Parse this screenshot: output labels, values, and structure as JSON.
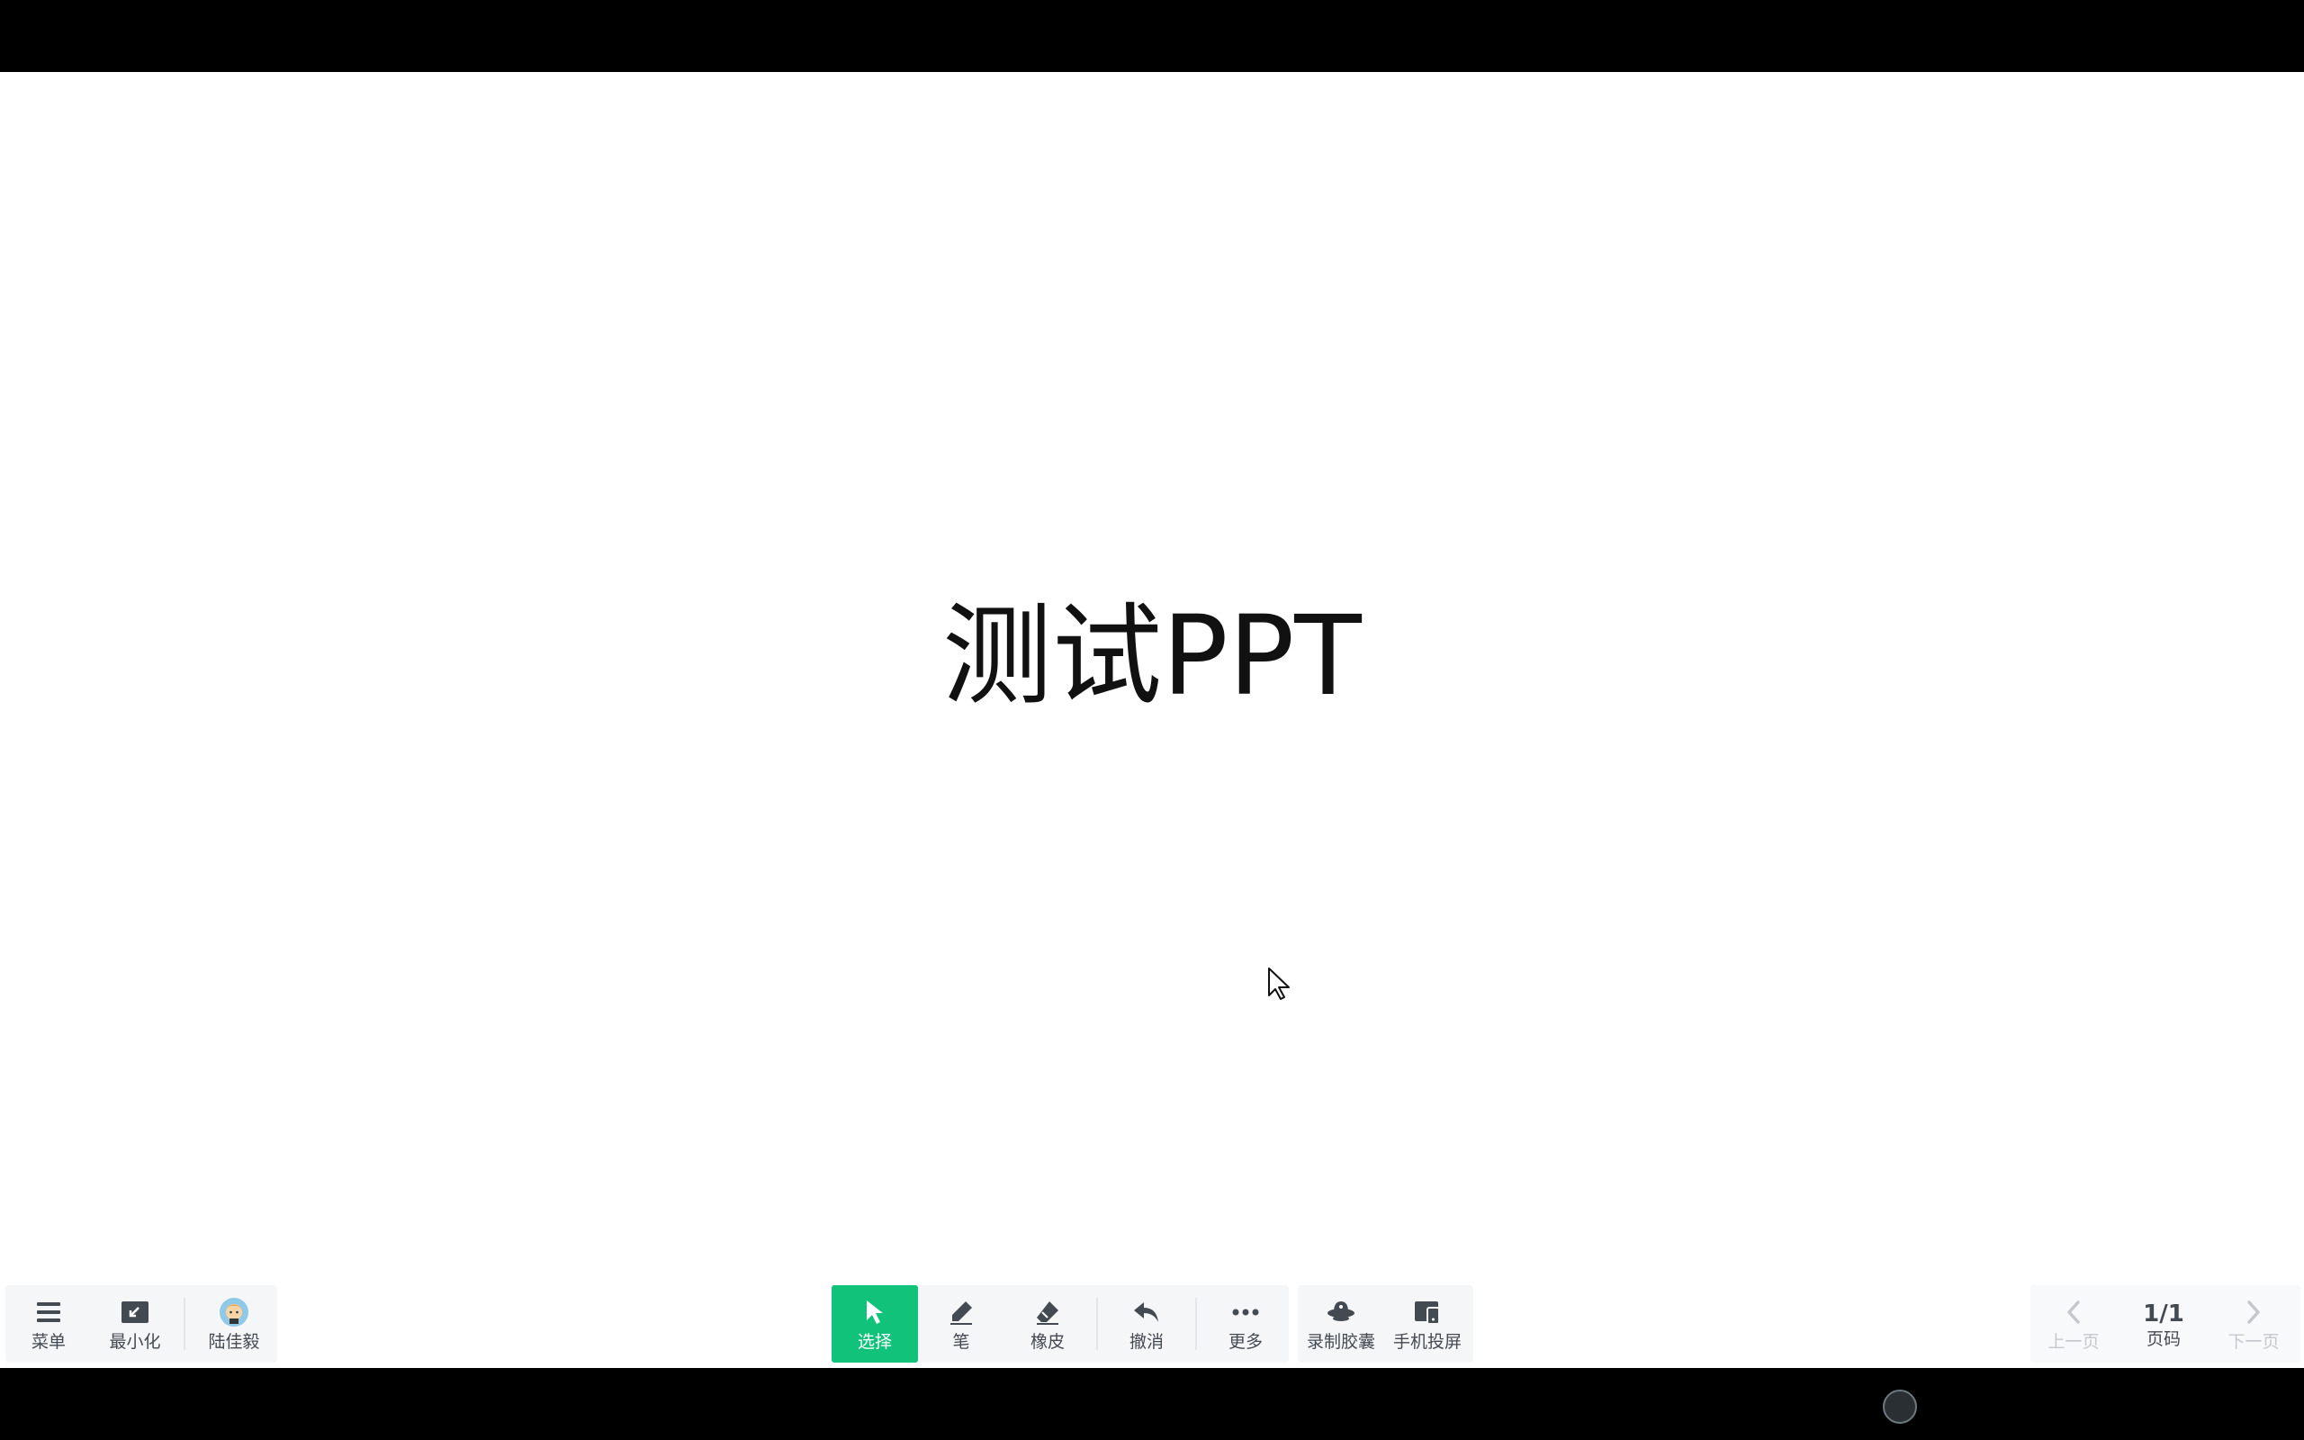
{
  "slide": {
    "title": "测试PPT"
  },
  "toolbar_left": {
    "menu_label": "菜单",
    "minimize_label": "最小化",
    "user_name": "陆佳毅"
  },
  "toolbar_center": {
    "select_label": "选择",
    "pen_label": "笔",
    "eraser_label": "橡皮",
    "undo_label": "撤消",
    "more_label": "更多"
  },
  "toolbar_extra": {
    "record_label": "录制胶囊",
    "cast_label": "手机投屏"
  },
  "toolbar_right": {
    "prev_label": "上一页",
    "page_value": "1/1",
    "page_label": "页码",
    "next_label": "下一页"
  },
  "icons": {
    "menu": "menu-icon",
    "minimize": "minimize-icon",
    "avatar": "avatar",
    "select": "pointer-icon",
    "pen": "pen-icon",
    "eraser": "eraser-icon",
    "undo": "undo-icon",
    "more": "more-icon",
    "record": "record-capsule-icon",
    "cast": "phone-cast-icon",
    "prev": "chevron-left-icon",
    "next": "chevron-right-icon"
  },
  "colors": {
    "accent": "#10c27a",
    "toolbar_bg": "#f5f6f7",
    "text": "#444a52",
    "disabled": "#c4c8cc"
  }
}
